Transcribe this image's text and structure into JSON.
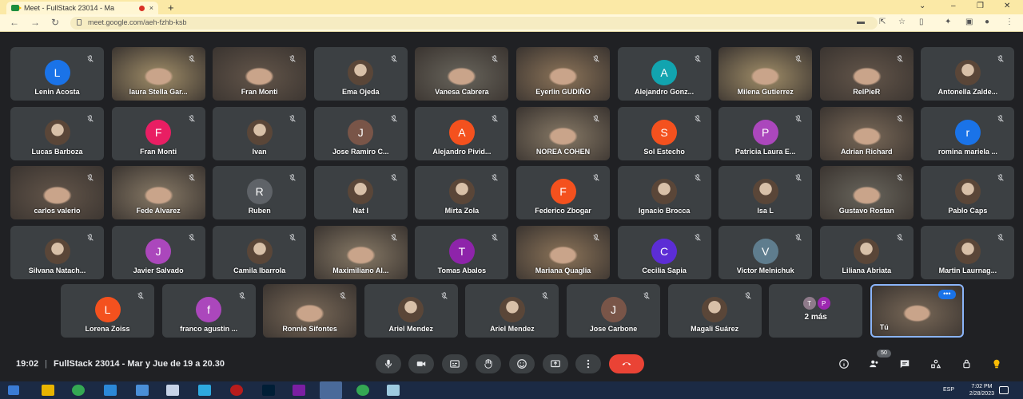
{
  "browser": {
    "tab_title": "Meet - FullStack 23014 - Ma",
    "tab_close": "×",
    "new_tab": "+",
    "url": "meet.google.com/aeh-fzhb-ksb",
    "window_controls": [
      "⌄",
      "–",
      "❐",
      "✕"
    ]
  },
  "tiles": [
    {
      "name": "Lenin Acosta",
      "kind": "letter",
      "letter": "L",
      "color": "#1a73e8"
    },
    {
      "name": "laura Stella Gar...",
      "kind": "video"
    },
    {
      "name": "Fran Monti",
      "kind": "video"
    },
    {
      "name": "Ema Ojeda",
      "kind": "photo"
    },
    {
      "name": "Vanesa Cabrera",
      "kind": "video"
    },
    {
      "name": "Eyerlin GUDIÑO",
      "kind": "video"
    },
    {
      "name": "Alejandro Gonz...",
      "kind": "letter",
      "letter": "A",
      "color": "#12a4af"
    },
    {
      "name": "Milena Gutierrez",
      "kind": "video"
    },
    {
      "name": "RelPieR",
      "kind": "video"
    },
    {
      "name": "Antonella Zalde...",
      "kind": "photo"
    },
    {
      "name": "Lucas Barboza",
      "kind": "photo"
    },
    {
      "name": "Fran Monti",
      "kind": "letter",
      "letter": "F",
      "color": "#e91e63"
    },
    {
      "name": "Ivan",
      "kind": "photo"
    },
    {
      "name": "Jose Ramiro C...",
      "kind": "letter",
      "letter": "J",
      "color": "#795548"
    },
    {
      "name": "Alejandro Pivid...",
      "kind": "letter",
      "letter": "A",
      "color": "#f4511e"
    },
    {
      "name": "NOREA COHEN",
      "kind": "video"
    },
    {
      "name": "Sol Estecho",
      "kind": "letter",
      "letter": "S",
      "color": "#f4511e"
    },
    {
      "name": "Patricia Laura E...",
      "kind": "letter",
      "letter": "P",
      "color": "#ab47bc"
    },
    {
      "name": "Adrian Richard",
      "kind": "video"
    },
    {
      "name": "romina mariela ...",
      "kind": "letter",
      "letter": "r",
      "color": "#1a73e8"
    },
    {
      "name": "carlos valerio",
      "kind": "video"
    },
    {
      "name": "Fede Alvarez",
      "kind": "video"
    },
    {
      "name": "Ruben",
      "kind": "letter",
      "letter": "R",
      "color": "#5f6368"
    },
    {
      "name": "Nat I",
      "kind": "photo"
    },
    {
      "name": "Mirta Zola",
      "kind": "photo"
    },
    {
      "name": "Federico Zbogar",
      "kind": "letter",
      "letter": "F",
      "color": "#f4511e"
    },
    {
      "name": "Ignacio Brocca",
      "kind": "photo"
    },
    {
      "name": "Isa L",
      "kind": "photo"
    },
    {
      "name": "Gustavo Rostan",
      "kind": "video"
    },
    {
      "name": "Pablo Caps",
      "kind": "photo"
    },
    {
      "name": "Silvana Natach...",
      "kind": "photo"
    },
    {
      "name": "Javier Salvado",
      "kind": "letter",
      "letter": "J",
      "color": "#ab47bc"
    },
    {
      "name": "Camila Ibarrola",
      "kind": "photo"
    },
    {
      "name": "Maximiliano Al...",
      "kind": "video"
    },
    {
      "name": "Tomas Abalos",
      "kind": "letter",
      "letter": "T",
      "color": "#8e24aa"
    },
    {
      "name": "Mariana Quaglia",
      "kind": "video"
    },
    {
      "name": "Cecilia Sapia",
      "kind": "letter",
      "letter": "C",
      "color": "#5c2dd5"
    },
    {
      "name": "Victor Melnichuk",
      "kind": "letter",
      "letter": "V",
      "color": "#5f7d8e"
    },
    {
      "name": "Liliana Abriata",
      "kind": "photo"
    },
    {
      "name": "Martin Laurnag...",
      "kind": "photo"
    },
    {
      "name": "Lorena Zoiss",
      "kind": "letter",
      "letter": "L",
      "color": "#f4511e"
    },
    {
      "name": "franco agustin ...",
      "kind": "letter",
      "letter": "f",
      "color": "#ab47bc"
    },
    {
      "name": "Ronnie Sifontes",
      "kind": "video"
    },
    {
      "name": "Ariel Mendez",
      "kind": "photo"
    },
    {
      "name": "Ariel Mendez",
      "kind": "photo"
    },
    {
      "name": "Jose Carbone",
      "kind": "letter",
      "letter": "J",
      "color": "#795548"
    },
    {
      "name": "Magali Suárez",
      "kind": "photo"
    },
    {
      "name": "2 más",
      "kind": "more",
      "letters": [
        "T",
        "P"
      ]
    },
    {
      "name": "Tú",
      "kind": "self",
      "more": "•••"
    }
  ],
  "meeting": {
    "time": "19:02",
    "title": "FullStack 23014 - Mar y Jue de 19 a 20.30",
    "people_count": "50"
  },
  "taskbar": {
    "lang": "ESP",
    "time": "7:02 PM",
    "date": "2/28/2023"
  }
}
